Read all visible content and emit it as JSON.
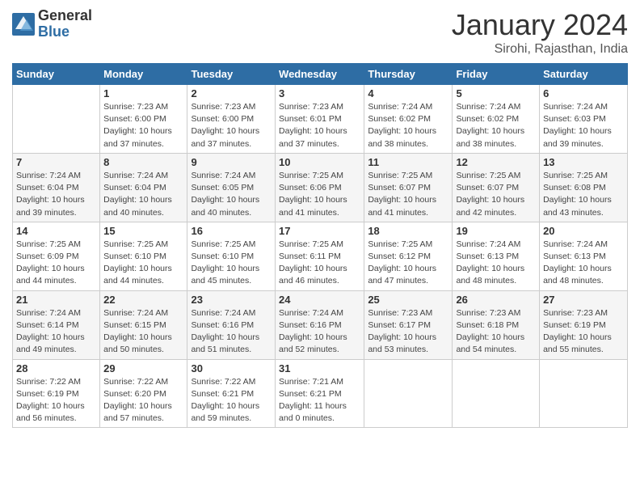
{
  "logo": {
    "general": "General",
    "blue": "Blue"
  },
  "header": {
    "month": "January 2024",
    "location": "Sirohi, Rajasthan, India"
  },
  "weekdays": [
    "Sunday",
    "Monday",
    "Tuesday",
    "Wednesday",
    "Thursday",
    "Friday",
    "Saturday"
  ],
  "weeks": [
    [
      {
        "day": "",
        "info": ""
      },
      {
        "day": "1",
        "info": "Sunrise: 7:23 AM\nSunset: 6:00 PM\nDaylight: 10 hours\nand 37 minutes."
      },
      {
        "day": "2",
        "info": "Sunrise: 7:23 AM\nSunset: 6:00 PM\nDaylight: 10 hours\nand 37 minutes."
      },
      {
        "day": "3",
        "info": "Sunrise: 7:23 AM\nSunset: 6:01 PM\nDaylight: 10 hours\nand 37 minutes."
      },
      {
        "day": "4",
        "info": "Sunrise: 7:24 AM\nSunset: 6:02 PM\nDaylight: 10 hours\nand 38 minutes."
      },
      {
        "day": "5",
        "info": "Sunrise: 7:24 AM\nSunset: 6:02 PM\nDaylight: 10 hours\nand 38 minutes."
      },
      {
        "day": "6",
        "info": "Sunrise: 7:24 AM\nSunset: 6:03 PM\nDaylight: 10 hours\nand 39 minutes."
      }
    ],
    [
      {
        "day": "7",
        "info": "Sunrise: 7:24 AM\nSunset: 6:04 PM\nDaylight: 10 hours\nand 39 minutes."
      },
      {
        "day": "8",
        "info": "Sunrise: 7:24 AM\nSunset: 6:04 PM\nDaylight: 10 hours\nand 40 minutes."
      },
      {
        "day": "9",
        "info": "Sunrise: 7:24 AM\nSunset: 6:05 PM\nDaylight: 10 hours\nand 40 minutes."
      },
      {
        "day": "10",
        "info": "Sunrise: 7:25 AM\nSunset: 6:06 PM\nDaylight: 10 hours\nand 41 minutes."
      },
      {
        "day": "11",
        "info": "Sunrise: 7:25 AM\nSunset: 6:07 PM\nDaylight: 10 hours\nand 41 minutes."
      },
      {
        "day": "12",
        "info": "Sunrise: 7:25 AM\nSunset: 6:07 PM\nDaylight: 10 hours\nand 42 minutes."
      },
      {
        "day": "13",
        "info": "Sunrise: 7:25 AM\nSunset: 6:08 PM\nDaylight: 10 hours\nand 43 minutes."
      }
    ],
    [
      {
        "day": "14",
        "info": "Sunrise: 7:25 AM\nSunset: 6:09 PM\nDaylight: 10 hours\nand 44 minutes."
      },
      {
        "day": "15",
        "info": "Sunrise: 7:25 AM\nSunset: 6:10 PM\nDaylight: 10 hours\nand 44 minutes."
      },
      {
        "day": "16",
        "info": "Sunrise: 7:25 AM\nSunset: 6:10 PM\nDaylight: 10 hours\nand 45 minutes."
      },
      {
        "day": "17",
        "info": "Sunrise: 7:25 AM\nSunset: 6:11 PM\nDaylight: 10 hours\nand 46 minutes."
      },
      {
        "day": "18",
        "info": "Sunrise: 7:25 AM\nSunset: 6:12 PM\nDaylight: 10 hours\nand 47 minutes."
      },
      {
        "day": "19",
        "info": "Sunrise: 7:24 AM\nSunset: 6:13 PM\nDaylight: 10 hours\nand 48 minutes."
      },
      {
        "day": "20",
        "info": "Sunrise: 7:24 AM\nSunset: 6:13 PM\nDaylight: 10 hours\nand 48 minutes."
      }
    ],
    [
      {
        "day": "21",
        "info": "Sunrise: 7:24 AM\nSunset: 6:14 PM\nDaylight: 10 hours\nand 49 minutes."
      },
      {
        "day": "22",
        "info": "Sunrise: 7:24 AM\nSunset: 6:15 PM\nDaylight: 10 hours\nand 50 minutes."
      },
      {
        "day": "23",
        "info": "Sunrise: 7:24 AM\nSunset: 6:16 PM\nDaylight: 10 hours\nand 51 minutes."
      },
      {
        "day": "24",
        "info": "Sunrise: 7:24 AM\nSunset: 6:16 PM\nDaylight: 10 hours\nand 52 minutes."
      },
      {
        "day": "25",
        "info": "Sunrise: 7:23 AM\nSunset: 6:17 PM\nDaylight: 10 hours\nand 53 minutes."
      },
      {
        "day": "26",
        "info": "Sunrise: 7:23 AM\nSunset: 6:18 PM\nDaylight: 10 hours\nand 54 minutes."
      },
      {
        "day": "27",
        "info": "Sunrise: 7:23 AM\nSunset: 6:19 PM\nDaylight: 10 hours\nand 55 minutes."
      }
    ],
    [
      {
        "day": "28",
        "info": "Sunrise: 7:22 AM\nSunset: 6:19 PM\nDaylight: 10 hours\nand 56 minutes."
      },
      {
        "day": "29",
        "info": "Sunrise: 7:22 AM\nSunset: 6:20 PM\nDaylight: 10 hours\nand 57 minutes."
      },
      {
        "day": "30",
        "info": "Sunrise: 7:22 AM\nSunset: 6:21 PM\nDaylight: 10 hours\nand 59 minutes."
      },
      {
        "day": "31",
        "info": "Sunrise: 7:21 AM\nSunset: 6:21 PM\nDaylight: 11 hours\nand 0 minutes."
      },
      {
        "day": "",
        "info": ""
      },
      {
        "day": "",
        "info": ""
      },
      {
        "day": "",
        "info": ""
      }
    ]
  ]
}
